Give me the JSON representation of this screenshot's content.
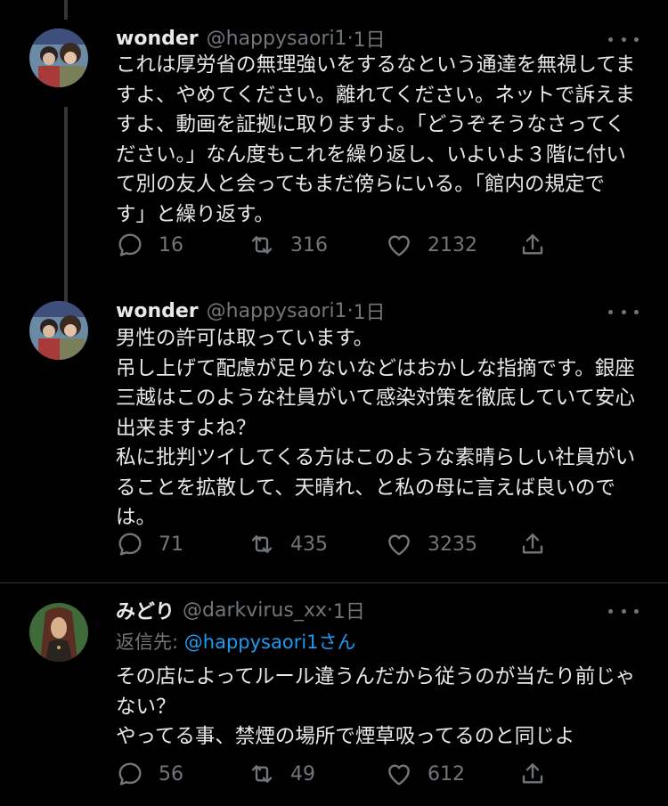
{
  "tweets": [
    {
      "name": "wonder",
      "handle": "@happysaori1",
      "time": "1日",
      "text": "これは厚労省の無理強いをするなという通達を無視してま\nすよ、やめてください。離れてください。ネットで訴えま\nすよ、動画を証拠に取りますよ。「どうぞそうなさってく\nださい。」なん度もこれを繰り返し、いよいよ３階に付い\nて別の友人と会ってもまだ傍らにいる。「館内の規定で\nす」と繰り返す。",
      "replies": "16",
      "retweets": "316",
      "likes": "2132"
    },
    {
      "name": "wonder",
      "handle": "@happysaori1",
      "time": "1日",
      "text": "男性の許可は取っています。\n吊し上げて配慮が足りないなどはおかしな指摘です。銀座\n三越はこのような社員がいて感染対策を徹底していて安心\n出来ますよね？\n私に批判ツイしてくる方はこのような素晴らしい社員がい\nることを拡散して、天晴れ、と私の母に言えば良いので\nは。",
      "replies": "71",
      "retweets": "435",
      "likes": "3235"
    },
    {
      "name": "みどり",
      "handle": "@darkvirus_xx",
      "time": "1日",
      "reply_prefix": "返信先: ",
      "reply_mention": "@happysaori1",
      "reply_suffix": "さん",
      "text": "その店によってルール違うんだから従うのが当たり前じゃ\nない？\nやってる事、禁煙の場所で煙草吸ってるのと同じよ",
      "replies": "56",
      "retweets": "49",
      "likes": "612"
    }
  ],
  "separator": " · ",
  "icons": {
    "reply": "reply-icon",
    "retweet": "retweet-icon",
    "like": "like-icon",
    "share": "share-icon",
    "more": "more-icon"
  },
  "colors": {
    "background": "#000000",
    "text": "#e7e9ea",
    "muted": "#71767b",
    "link": "#1d9bf0",
    "divider": "#2f3336"
  }
}
